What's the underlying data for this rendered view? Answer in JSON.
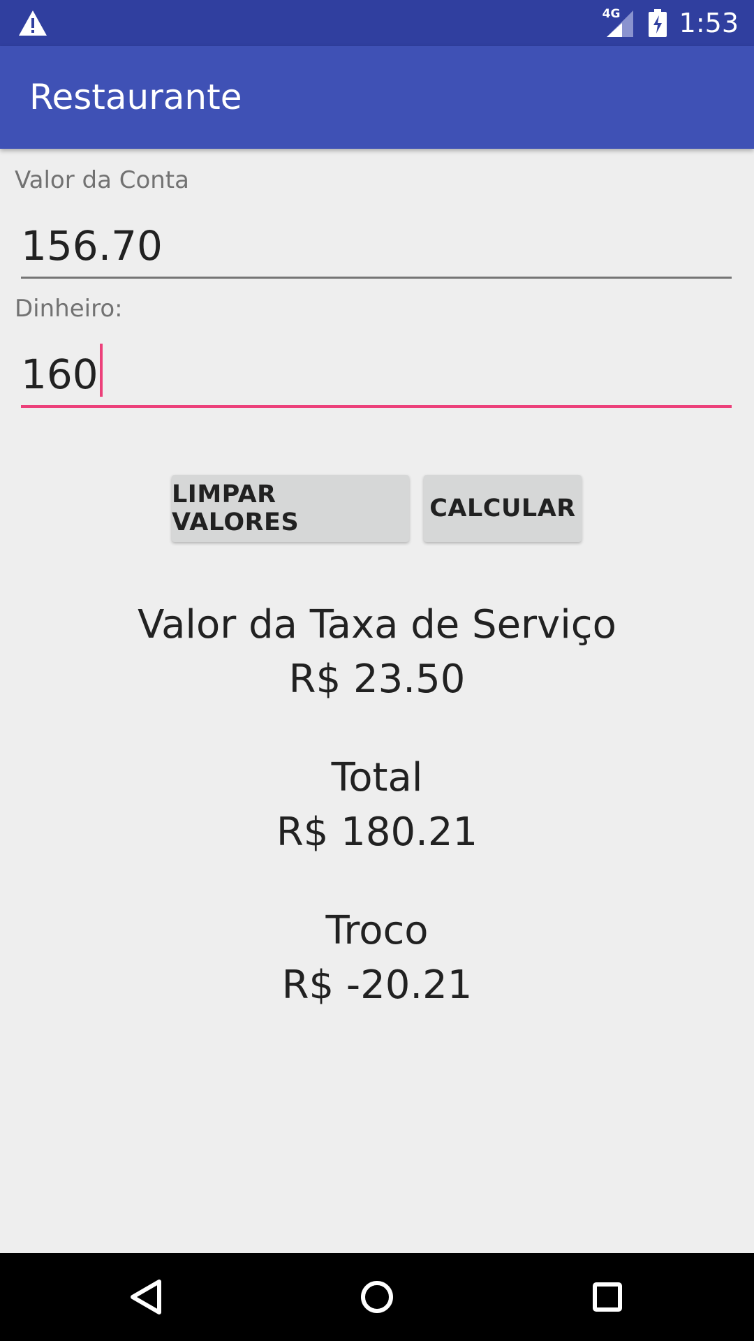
{
  "status_bar": {
    "network_type": "4G",
    "time": "1:53",
    "icons": [
      "warning-icon",
      "signal-icon",
      "battery-charging-icon"
    ]
  },
  "app_bar": {
    "title": "Restaurante"
  },
  "form": {
    "valor_conta": {
      "label": "Valor da Conta",
      "value": "156.70"
    },
    "dinheiro": {
      "label": "Dinheiro:",
      "value": "160"
    }
  },
  "buttons": {
    "limpar": "LIMPAR VALORES",
    "calcular": "CALCULAR"
  },
  "results": {
    "taxa_label": "Valor da Taxa de Serviço",
    "taxa_value": "R$ 23.50",
    "total_label": "Total",
    "total_value": "R$ 180.21",
    "troco_label": "Troco",
    "troco_value": "R$ -20.21"
  },
  "nav_bar": {
    "icons": [
      "back-icon",
      "home-icon",
      "recents-icon"
    ]
  },
  "colors": {
    "status_bar": "#303f9f",
    "app_bar": "#3f51b5",
    "accent": "#ec407a",
    "background": "#eeeeee",
    "button": "#d6d7d7"
  }
}
